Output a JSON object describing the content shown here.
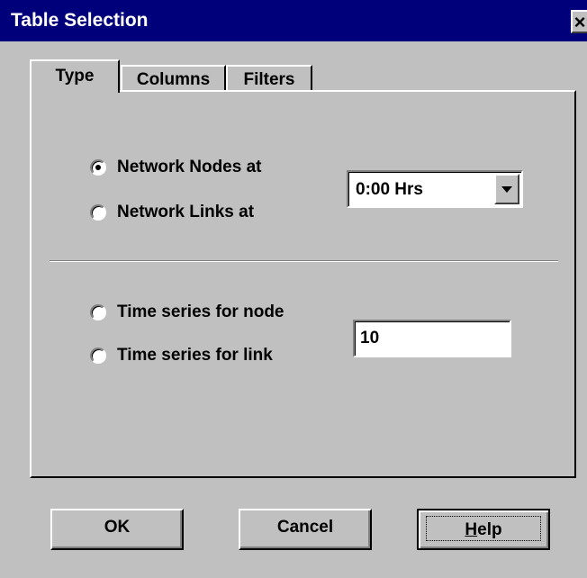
{
  "window": {
    "title": "Table Selection",
    "close_label": "×"
  },
  "tabs": [
    {
      "label": "Type",
      "active": true
    },
    {
      "label": "Columns",
      "active": false
    },
    {
      "label": "Filters",
      "active": false
    }
  ],
  "type_tab": {
    "network_nodes_label": "Network Nodes at",
    "network_links_label": "Network Links at",
    "time_value": "0:00 Hrs",
    "time_series_node_label": "Time series for node",
    "time_series_link_label": "Time series for link",
    "object_id_value": "10",
    "selected_option": "Network Nodes at"
  },
  "buttons": {
    "ok_label": "OK",
    "cancel_label": "Cancel",
    "help_mnemonic": "H",
    "help_rest": "elp"
  },
  "icons": {
    "close": "close-icon",
    "dropdown": "chevron-down-icon"
  },
  "colors": {
    "titlebar": "#00007b",
    "face": "#c0c0c0"
  }
}
